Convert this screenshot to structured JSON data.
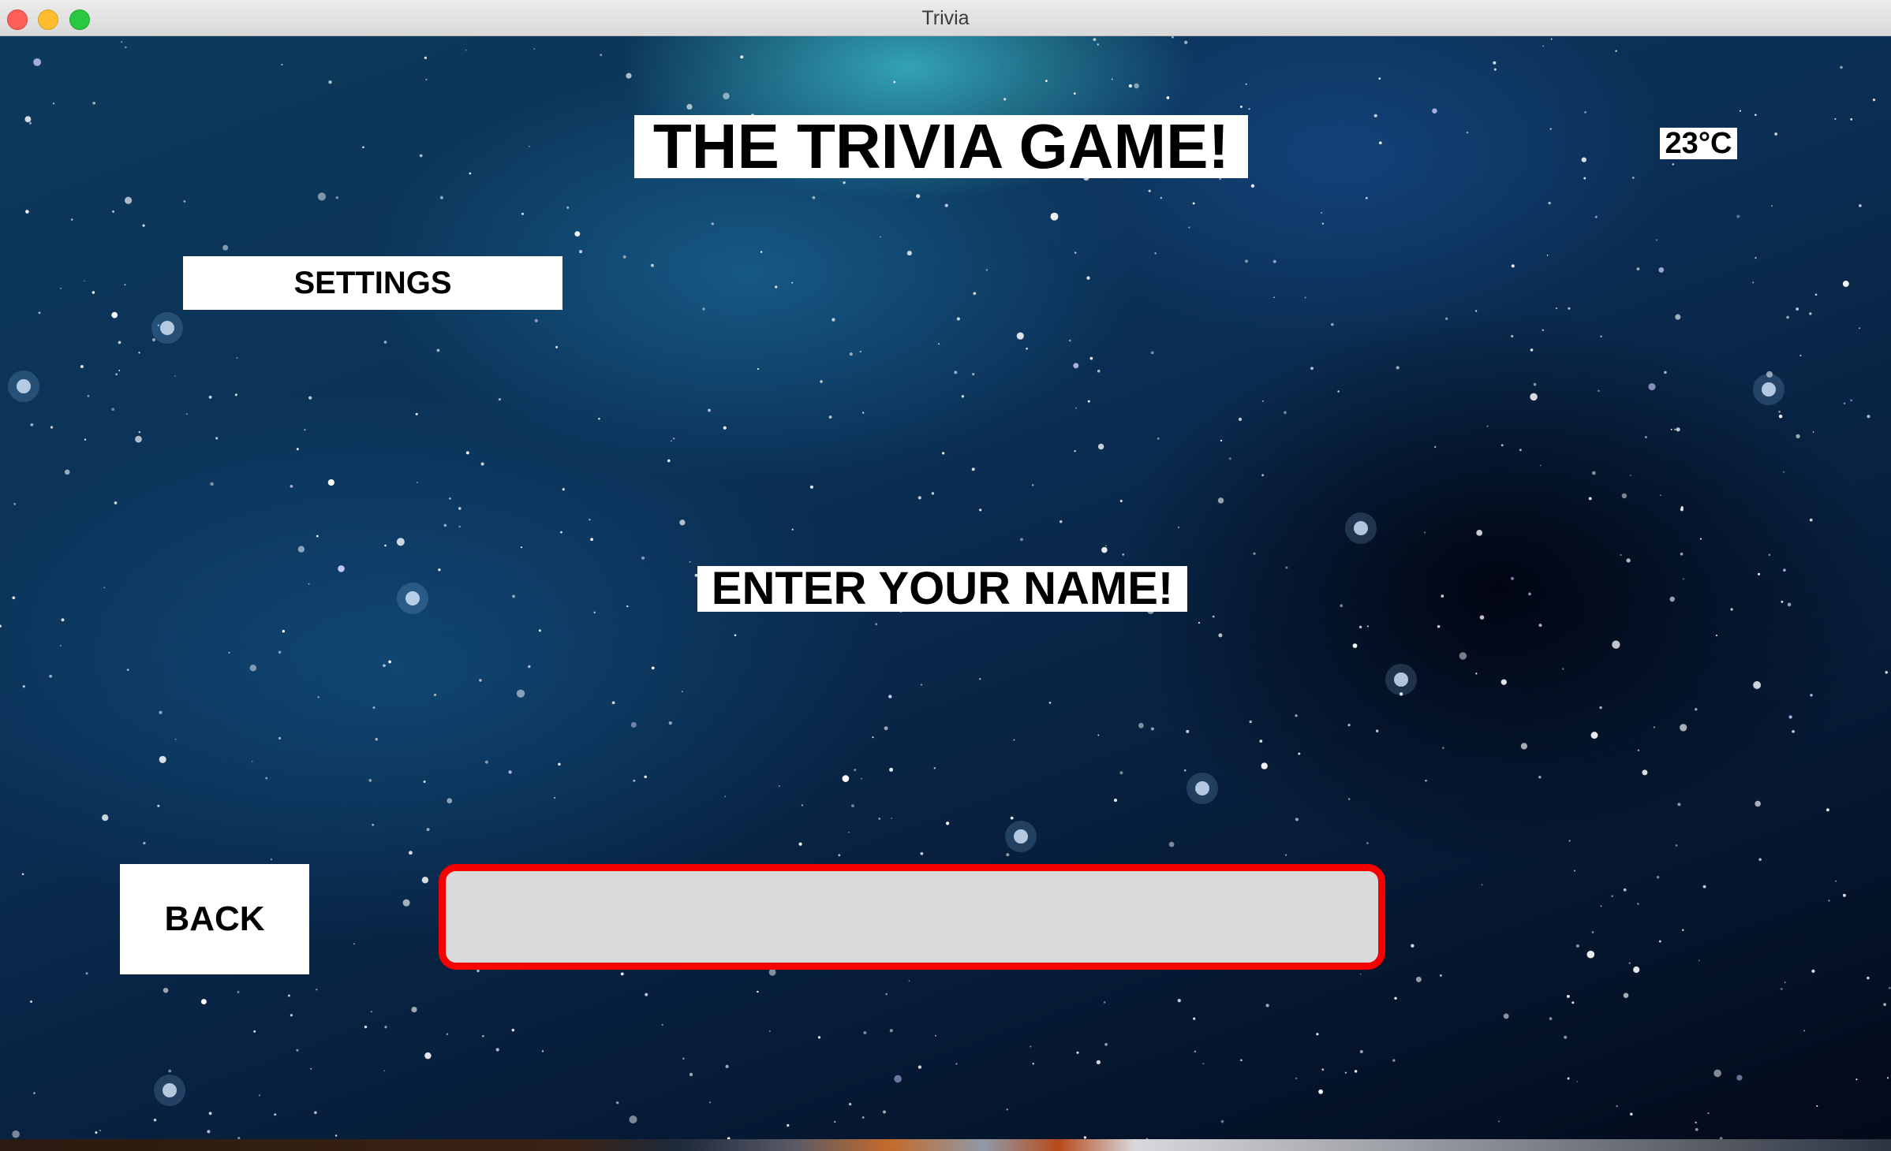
{
  "window": {
    "title": "Trivia"
  },
  "game": {
    "title": "THE TRIVIA GAME!",
    "temperature": "23°C",
    "settings_label": "SETTINGS",
    "prompt": "ENTER YOUR NAME!",
    "back_label": "BACK",
    "name_input": {
      "value": "",
      "placeholder": ""
    }
  },
  "colors": {
    "input_border": "#f70000",
    "input_fill": "#dadada",
    "label_background": "#ffffff"
  }
}
